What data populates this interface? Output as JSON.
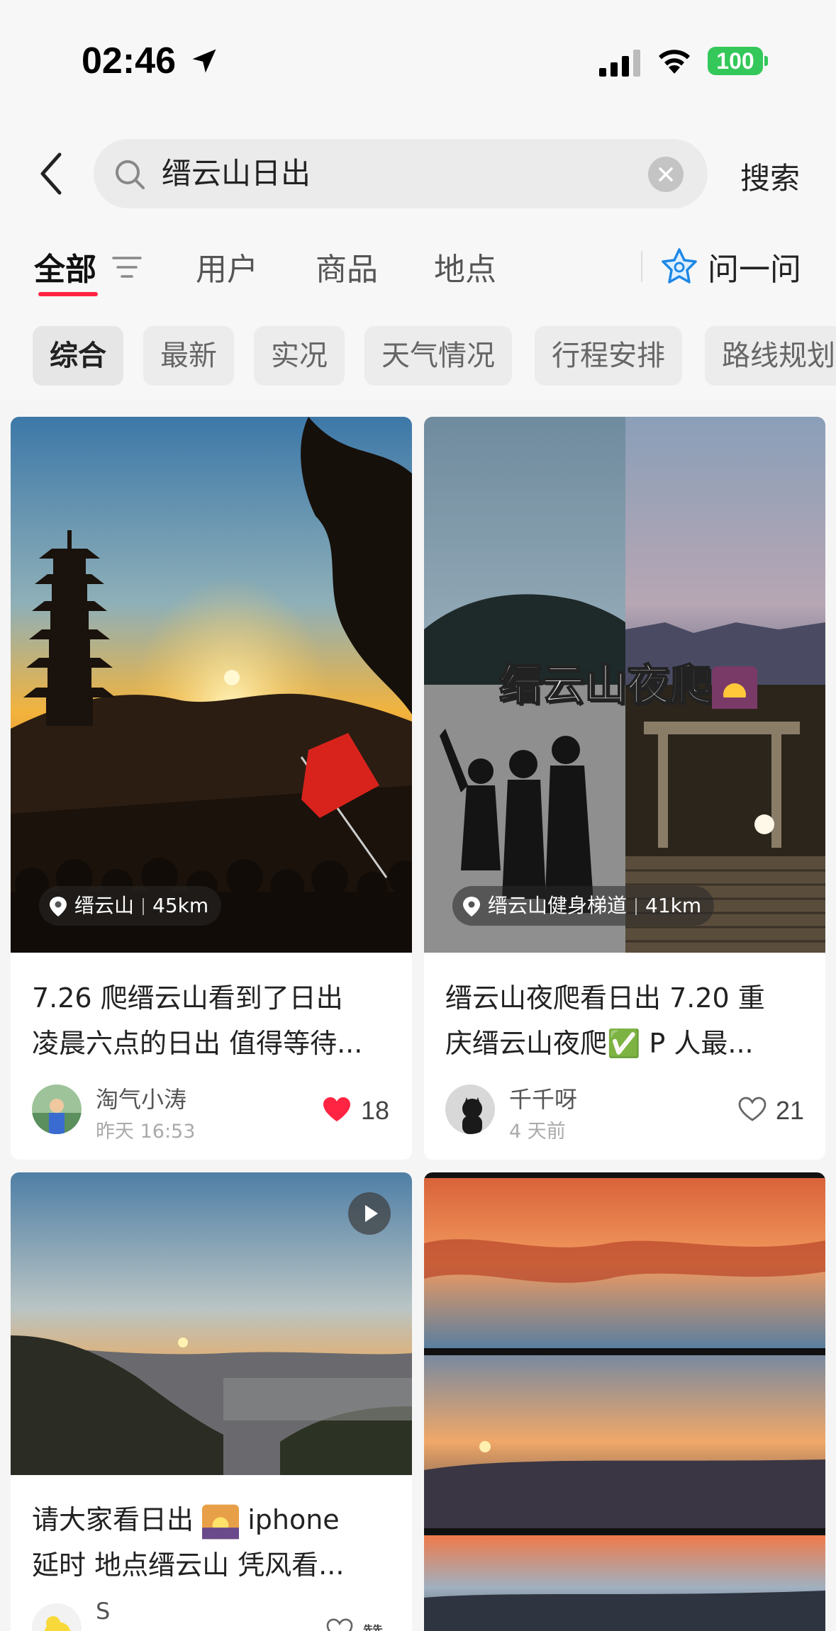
{
  "status_bar": {
    "time": "02:46",
    "battery": "100"
  },
  "search": {
    "back_icon": "chevron-left-icon",
    "query": "缙云山日出",
    "submit_label": "搜索"
  },
  "tabs": {
    "items": [
      {
        "label": "全部"
      },
      {
        "label": "用户"
      },
      {
        "label": "商品"
      },
      {
        "label": "地点"
      }
    ],
    "active": 0,
    "ask_label": "问一问"
  },
  "chips": [
    "综合",
    "最新",
    "实况",
    "天气情况",
    "行程安排",
    "路线规划"
  ],
  "cards": [
    {
      "location": "缙云山",
      "distance": "45km",
      "title_lines": [
        "7.26 爬缙云山看到了日出",
        "凌晨六点的日出 值得等待..."
      ],
      "author": "淘气小涛",
      "time": "昨天 16:53",
      "likes": "18",
      "liked": true
    },
    {
      "overlay_title": "缙云山夜爬",
      "location": "缙云山健身梯道",
      "distance": "41km",
      "title_lines": [
        "缙云山夜爬看日出 7.20 重",
        "庆缙云山夜爬✅ P 人最..."
      ],
      "author": "千千呀",
      "time": "4 天前",
      "likes": "21",
      "liked": false
    },
    {
      "title_lines": [
        "请大家看日出",
        "延时 地点缙云山 凭风看..."
      ],
      "title_suffix": " iphone",
      "author": "S",
      "likes": "赞"
    },
    {}
  ],
  "colors": {
    "accent": "#ff2442",
    "like_red": "#ff2442",
    "battery_green": "#34c759"
  }
}
